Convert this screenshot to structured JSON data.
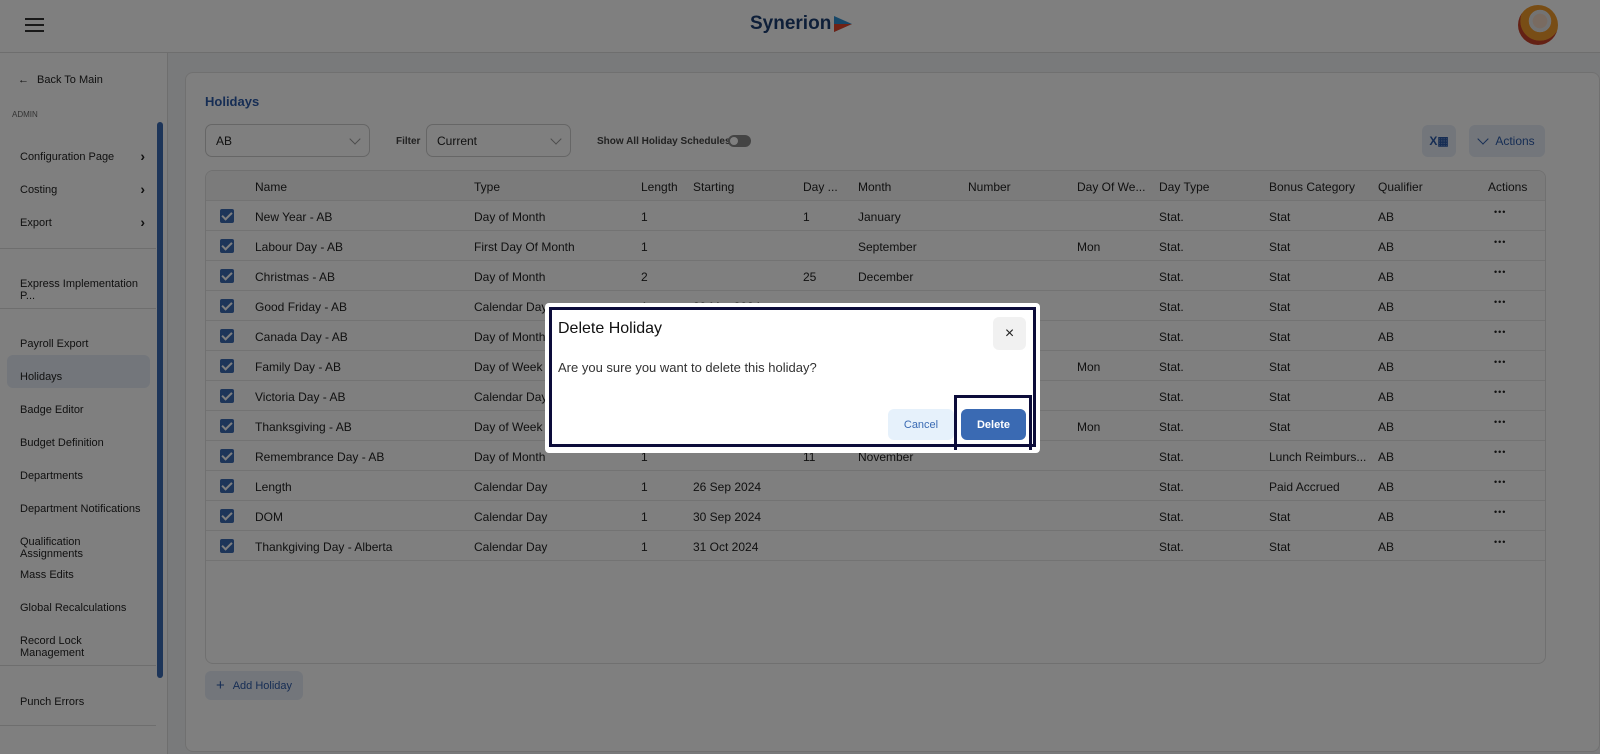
{
  "header": {
    "brand": "Synerion",
    "menu_icon": "hamburger-icon",
    "avatar": "user-avatar"
  },
  "sidebar": {
    "back": "Back To Main",
    "section": "ADMIN",
    "items": [
      {
        "label": "Configuration Page",
        "chevron": true
      },
      {
        "label": "Costing",
        "chevron": true
      },
      {
        "label": "Export",
        "chevron": true
      },
      {
        "label": "Express Implementation P..."
      },
      {
        "label": "Payroll Export"
      },
      {
        "label": "Holidays",
        "active": true
      },
      {
        "label": "Badge Editor"
      },
      {
        "label": "Budget Definition"
      },
      {
        "label": "Departments"
      },
      {
        "label": "Department Notifications"
      },
      {
        "label": "Qualification Assignments"
      },
      {
        "label": "Mass Edits"
      },
      {
        "label": "Global Recalculations"
      },
      {
        "label": "Record Lock Management"
      },
      {
        "label": "Punch Errors"
      }
    ]
  },
  "page": {
    "title": "Holidays",
    "schedule": "AB",
    "filter_label": "Filter",
    "filter_value": "Current",
    "show_all_label": "Show All Holiday Schedules",
    "show_all_on": false,
    "excel_icon": "excel-icon",
    "actions_label": "Actions",
    "add_label": "Add Holiday",
    "accent": "#3a6ab3"
  },
  "table": {
    "columns": [
      "Name",
      "Type",
      "Length",
      "Starting",
      "Day ...",
      "Month",
      "Number",
      "Day Of We...",
      "Day Type",
      "Bonus Category",
      "Qualifier",
      "Actions"
    ],
    "rows": [
      [
        "New Year - AB",
        "Day of Month",
        "1",
        "",
        "1",
        "January",
        "",
        "",
        "Stat.",
        "Stat",
        "AB"
      ],
      [
        "Labour Day - AB",
        "First Day Of Month",
        "1",
        "",
        "",
        "September",
        "",
        "Mon",
        "Stat.",
        "Stat",
        "AB"
      ],
      [
        "Christmas - AB",
        "Day of Month",
        "2",
        "",
        "25",
        "December",
        "",
        "",
        "Stat.",
        "Stat",
        "AB"
      ],
      [
        "Good Friday - AB",
        "Calendar Day",
        "1",
        "29 Mar 2024",
        "",
        "",
        "",
        "",
        "Stat.",
        "Stat",
        "AB"
      ],
      [
        "Canada Day - AB",
        "Day of Month",
        "",
        "",
        "",
        "",
        "",
        "",
        "Stat.",
        "Stat",
        "AB"
      ],
      [
        "Family Day - AB",
        "Day of Week",
        "",
        "",
        "",
        "",
        "",
        "Mon",
        "Stat.",
        "Stat",
        "AB"
      ],
      [
        "Victoria Day - AB",
        "Calendar Day",
        "",
        "",
        "",
        "",
        "",
        "",
        "Stat.",
        "Stat",
        "AB"
      ],
      [
        "Thanksgiving - AB",
        "Day of Week",
        "",
        "",
        "",
        "",
        "",
        "Mon",
        "Stat.",
        "Stat",
        "AB"
      ],
      [
        "Remembrance Day - AB",
        "Day of Month",
        "1",
        "",
        "11",
        "November",
        "",
        "",
        "Stat.",
        "Lunch Reimburs...",
        "AB"
      ],
      [
        "Length",
        "Calendar Day",
        "1",
        "26 Sep 2024",
        "",
        "",
        "",
        "",
        "Stat.",
        "Paid Accrued",
        "AB"
      ],
      [
        "DOM",
        "Calendar Day",
        "1",
        "30 Sep 2024",
        "",
        "",
        "",
        "",
        "Stat.",
        "Stat",
        "AB"
      ],
      [
        "Thankgiving Day - Alberta",
        "Calendar Day",
        "1",
        "31 Oct 2024",
        "",
        "",
        "",
        "",
        "Stat.",
        "Stat",
        "AB"
      ]
    ]
  },
  "modal": {
    "title": "Delete Holiday",
    "message": "Are you sure you want to delete this holiday?",
    "cancel": "Cancel",
    "delete": "Delete",
    "close": "×"
  }
}
